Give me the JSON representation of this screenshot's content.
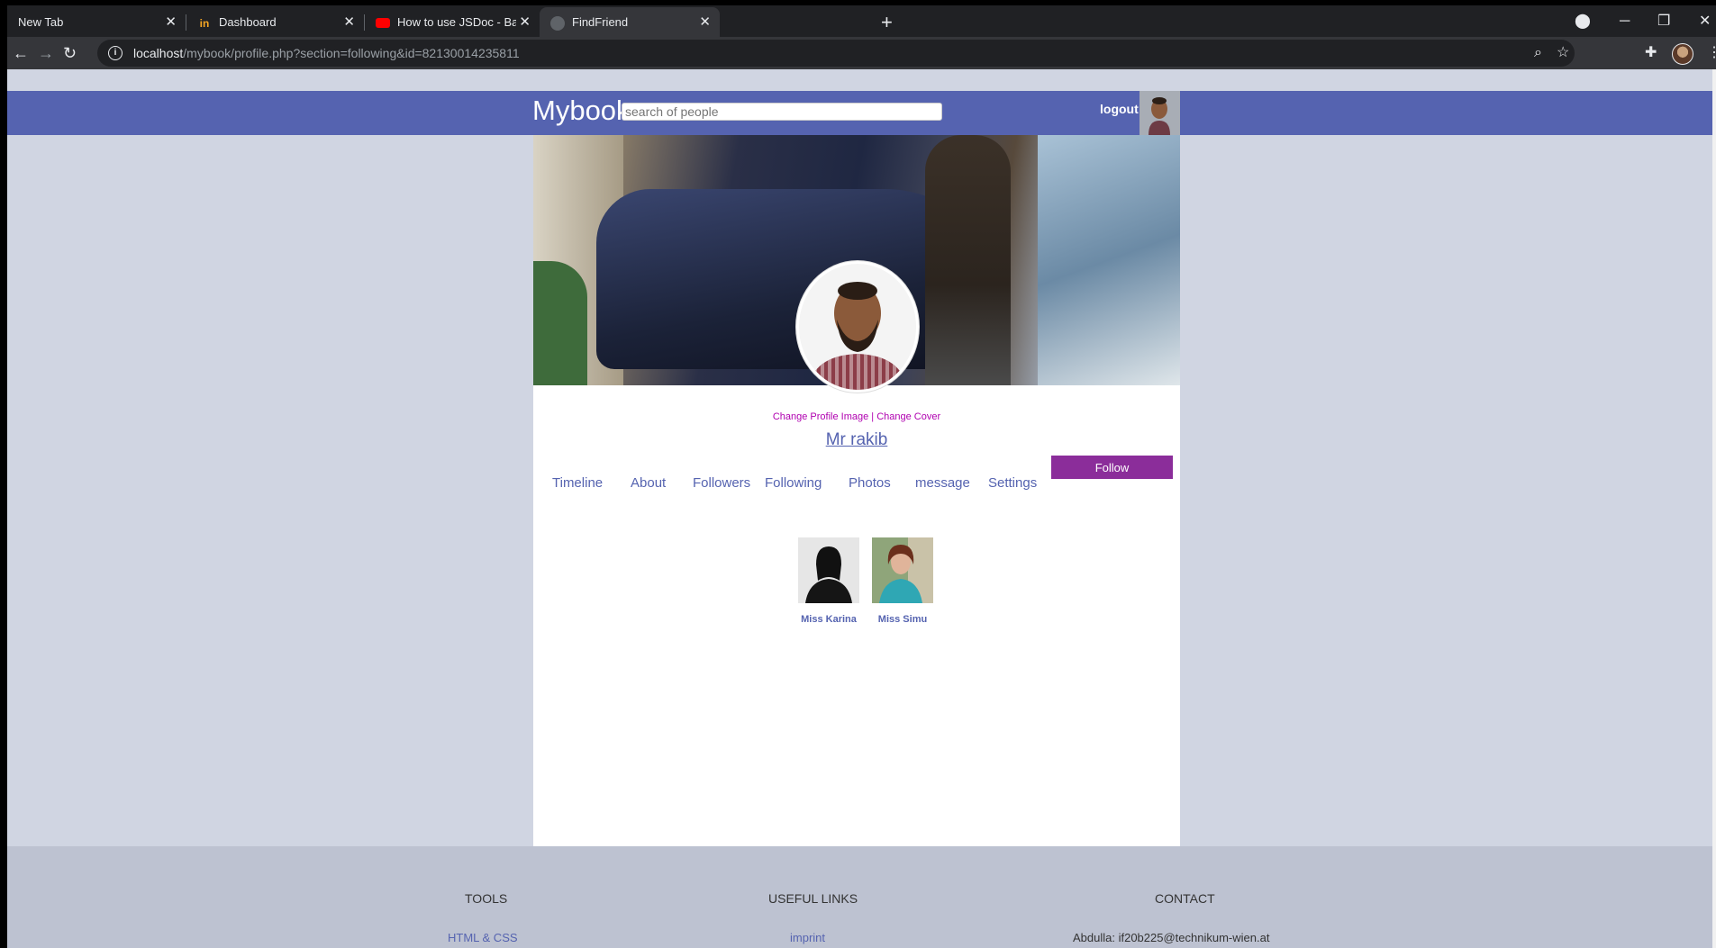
{
  "browser": {
    "tabs": [
      {
        "title": "New Tab"
      },
      {
        "title": "Dashboard"
      },
      {
        "title": "How to use JSDoc - Basics & Intr"
      },
      {
        "title": "FindFriend"
      }
    ],
    "url_host": "localhost",
    "url_path": "/mybook/profile.php?section=following&id=82130014235811"
  },
  "header": {
    "brand": "Mybook",
    "search_placeholder": "search of people",
    "logout_label": "logout"
  },
  "profile": {
    "change_profile_image": "Change Profile Image",
    "separator": "|",
    "change_cover": "Change Cover",
    "name": "Mr rakib",
    "follow_label": "Follow",
    "menu": [
      "Timeline",
      "About",
      "Followers",
      "Following",
      "Photos",
      "message",
      "Settings"
    ]
  },
  "following": [
    {
      "name": "Miss Karina"
    },
    {
      "name": "Miss Simu"
    }
  ],
  "footer": {
    "tools_heading": "TOOLS",
    "links_heading": "USEFUL LINKS",
    "contact_heading": "CONTACT",
    "tools_link": "HTML & CSS",
    "links_link": "imprint",
    "contact_text": "Abdulla: if20b225@technikum-wien.at"
  },
  "colors": {
    "topbar": "#5563b0",
    "follow_button": "#8b2d9a",
    "page_bg": "#d0d5e2",
    "footer_bg": "#bdc2d1",
    "change_links": "#b000b0"
  }
}
